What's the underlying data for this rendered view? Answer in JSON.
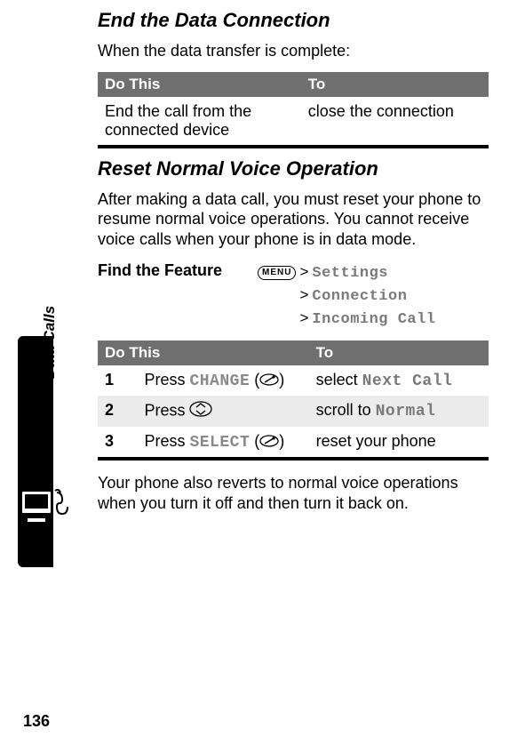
{
  "section_label": "Data Calls",
  "page_number": "136",
  "h1": "End the Data Connection",
  "p1": "When the data transfer is complete:",
  "table1": {
    "head_do": "Do This",
    "head_to": "To",
    "row1_do": "End the call from the connected device",
    "row1_to": "close the connection"
  },
  "h2": "Reset Normal Voice Operation",
  "p2": "After making a data call, you must reset your phone to resume normal voice operations. You cannot receive voice calls when your phone is in data mode.",
  "feature": {
    "label": "Find the Feature",
    "menu_glyph": "MENU",
    "gt": ">",
    "path1": "Settings",
    "path2": "Connection",
    "path3": "Incoming Call"
  },
  "table2": {
    "head_do": "Do This",
    "head_to": "To",
    "rows": [
      {
        "n": "1",
        "do_pre": "Press ",
        "do_key": "CHANGE",
        "do_post": " (",
        "do_close": ")",
        "to_pre": "select ",
        "to_key": "Next Call"
      },
      {
        "n": "2",
        "do_pre": "Press ",
        "do_key": "",
        "do_post": "",
        "do_close": "",
        "to_pre": "scroll to ",
        "to_key": "Normal"
      },
      {
        "n": "3",
        "do_pre": "Press ",
        "do_key": "SELECT",
        "do_post": " (",
        "do_close": ")",
        "to_pre": "reset your phone",
        "to_key": ""
      }
    ]
  },
  "p3": "Your phone also reverts to normal voice operations when you turn it off and then turn it back on."
}
